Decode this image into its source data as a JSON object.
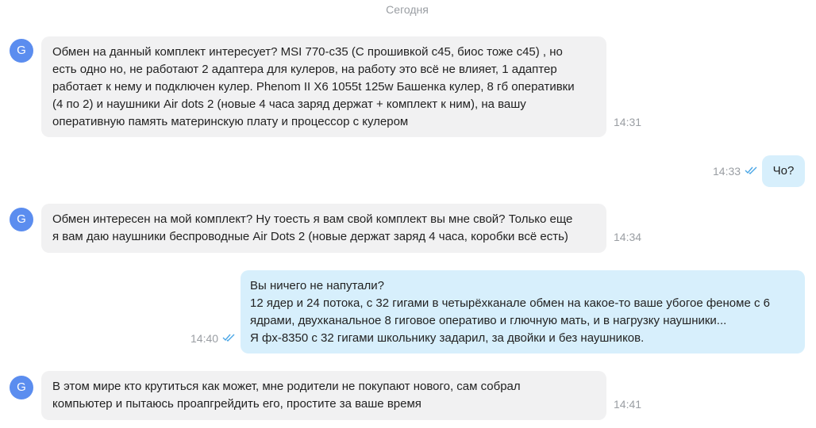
{
  "chat": {
    "date_separator": "Сегодня",
    "messages": [
      {
        "direction": "incoming",
        "avatar_letter": "G",
        "lines": [
          "Обмен на данный комплект интересует? MSI 770-c35 (С прошивкой с45, биос тоже с45) , но",
          "есть одно но, не работают 2 адаптера для кулеров, на работу это всё не влияет, 1 адаптер",
          "работает к нему и подключен кулер. Phenom II X6 1055t 125w Башенка кулер, 8 гб оперативки",
          "(4 по 2) и наушники Air dots 2 (новые 4 часа заряд держат + комплект к ним), на вашу",
          "оперативную память материнскую плату и процессор с кулером"
        ],
        "time": "14:31"
      },
      {
        "direction": "outgoing",
        "lines": [
          "Чо?"
        ],
        "time": "14:33",
        "status": "read-double-check"
      },
      {
        "direction": "incoming",
        "avatar_letter": "G",
        "lines": [
          "Обмен интересен на мой комплект? Ну тоесть я вам свой комплект вы мне свой? Только еще",
          "я вам даю наушники беспроводные Air Dots 2 (новые держат заряд 4 часа, коробки всё есть)"
        ],
        "time": "14:34"
      },
      {
        "direction": "outgoing",
        "lines": [
          "Вы ничего не напутали?",
          "12 ядер и 24 потока, с 32 гигами в четырёхканале обмен на какое-то ваше убогое феноме с 6",
          "ядрами, двухканальное 8 гиговое оперативо и глючную мать, и в нагрузку наушники...",
          "Я фх-8350 с 32 гигами школьнику задарил, за двойки и без наушников."
        ],
        "time": "14:40",
        "status": "read-double-check"
      },
      {
        "direction": "incoming",
        "avatar_letter": "G",
        "lines": [
          "В этом мире кто крутиться как может, мне родители не покупают нового, сам собрал",
          "компьютер и пытаюсь проапгрейдить его, простите за ваше время"
        ],
        "time": "14:41"
      }
    ]
  },
  "colors": {
    "incoming_bubble": "#f1f1f2",
    "outgoing_bubble": "#d7effc",
    "avatar": "#5b8def",
    "read_check": "#4aa6e6",
    "meta_text": "#9a9ea3"
  }
}
